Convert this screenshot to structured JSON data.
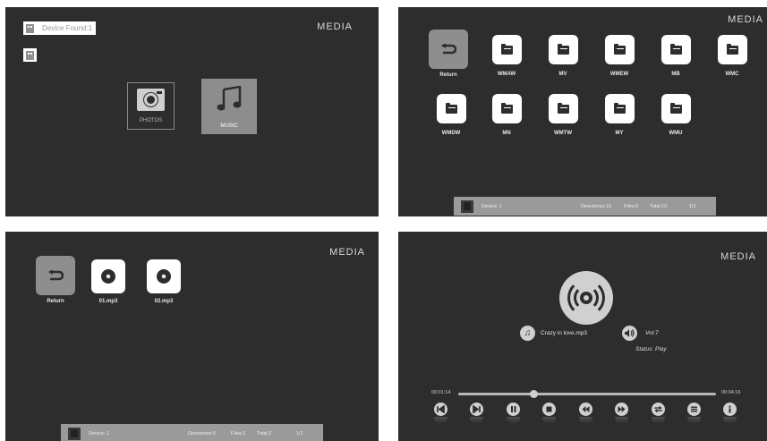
{
  "panel1": {
    "media": "MEDIA",
    "device_found": "Device Found:1",
    "photos_label": "PHOTOS",
    "music_label": "MUSIC"
  },
  "panel2": {
    "media": "MEDIA",
    "items": [
      "Return",
      "WMAW",
      "MV",
      "WMEW",
      "MB",
      "WMC",
      "WMDW",
      "MN",
      "WMTW",
      "MY",
      "WMU"
    ],
    "status": {
      "device": "Device: 1",
      "directories": "Directories:10",
      "files": "Files:0",
      "total": "Total:10",
      "page": "1/1"
    }
  },
  "panel3": {
    "media": "MEDIA",
    "items": [
      "Return",
      "01.mp3",
      "02.mp3"
    ],
    "status": {
      "device": "Device: 1",
      "directories": "Directories:0",
      "files": "Files:2",
      "total": "Total:2",
      "page": "1/1"
    }
  },
  "panel4": {
    "media": "MEDIA",
    "song": "Crazy in love.mp3",
    "volume": "Vol:7",
    "status": "Status: Play",
    "elapsed": "00:01:14",
    "duration": "00:04:16",
    "progress": 0.29,
    "controls": [
      "prev-icon",
      "next-icon",
      "pause-icon",
      "stop-icon",
      "rewind-icon",
      "fast-forward-icon",
      "repeat-icon",
      "playlist-icon",
      "info-icon"
    ]
  },
  "colors": {
    "background": "#2e2d2d",
    "accent": "#8d8d8d",
    "tile": "#ffffff"
  }
}
